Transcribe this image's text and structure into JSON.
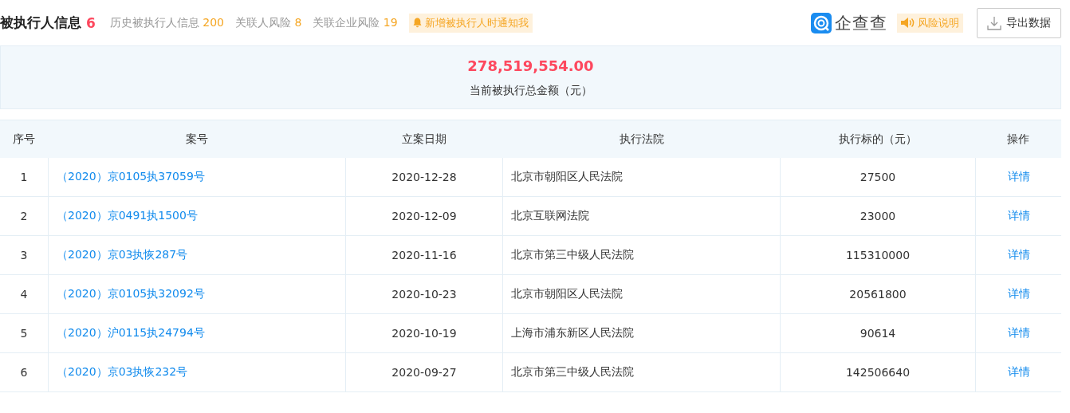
{
  "header": {
    "title": "被执行人信息",
    "count": "6",
    "tabs": [
      {
        "label": "历史被执行人信息",
        "count": "200"
      },
      {
        "label": "关联人风险",
        "count": "8"
      },
      {
        "label": "关联企业风险",
        "count": "19"
      }
    ],
    "notify": "新增被执行人时通知我",
    "brand": "企查查",
    "risk_note": "风险说明",
    "export": "导出数据"
  },
  "summary": {
    "amount": "278,519,554.00",
    "label": "当前被执行总金额（元）"
  },
  "table": {
    "columns": [
      "序号",
      "案号",
      "立案日期",
      "执行法院",
      "执行标的（元）",
      "操作"
    ],
    "rows": [
      {
        "no": "1",
        "case": "（2020）京0105执37059号",
        "date": "2020-12-28",
        "court": "北京市朝阳区人民法院",
        "amount": "27500",
        "action": "详情"
      },
      {
        "no": "2",
        "case": "（2020）京0491执1500号",
        "date": "2020-12-09",
        "court": "北京互联网法院",
        "amount": "23000",
        "action": "详情"
      },
      {
        "no": "3",
        "case": "（2020）京03执恢287号",
        "date": "2020-11-16",
        "court": "北京市第三中级人民法院",
        "amount": "115310000",
        "action": "详情"
      },
      {
        "no": "4",
        "case": "（2020）京0105执32092号",
        "date": "2020-10-23",
        "court": "北京市朝阳区人民法院",
        "amount": "20561800",
        "action": "详情"
      },
      {
        "no": "5",
        "case": "（2020）沪0115执24794号",
        "date": "2020-10-19",
        "court": "上海市浦东新区人民法院",
        "amount": "90614",
        "action": "详情"
      },
      {
        "no": "6",
        "case": "（2020）京03执恢232号",
        "date": "2020-09-27",
        "court": "北京市第三中级人民法院",
        "amount": "142506640",
        "action": "详情"
      }
    ]
  }
}
